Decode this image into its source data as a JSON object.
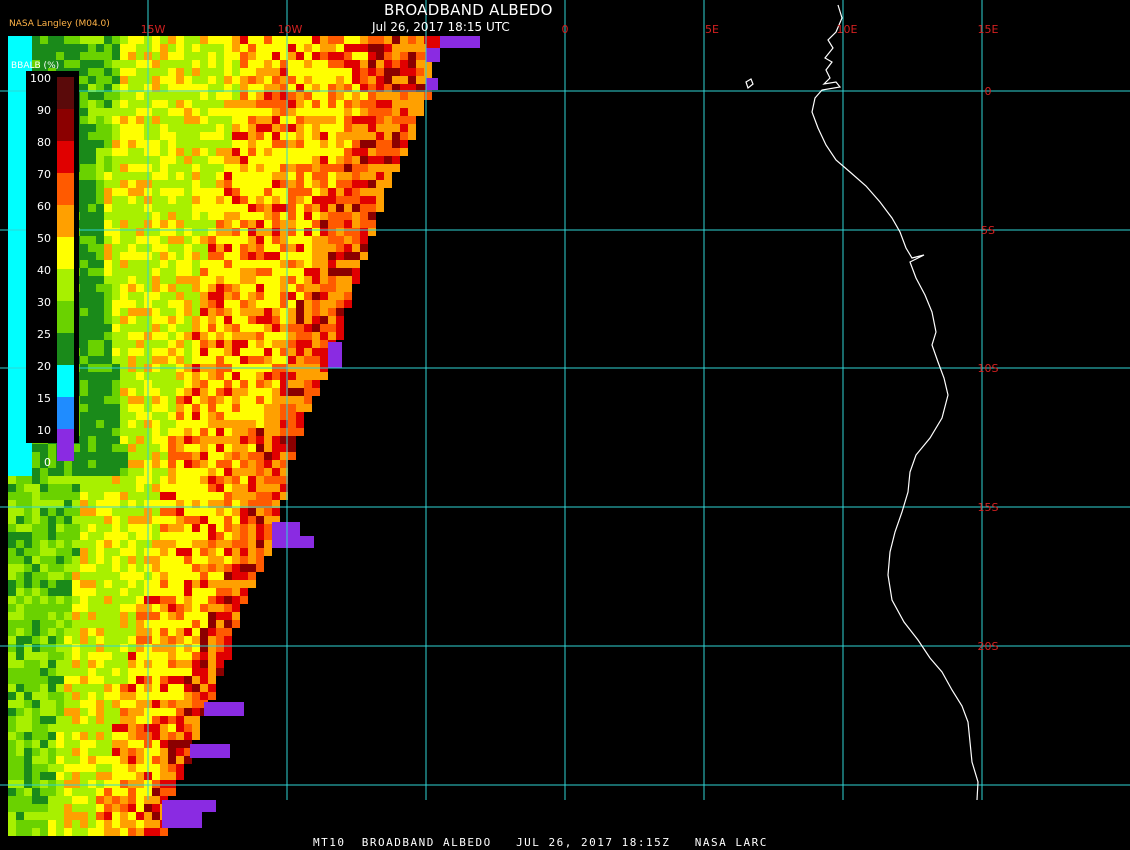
{
  "header": {
    "title": "BROADBAND ALBEDO",
    "subtitle": "Jul 26, 2017 18:15 UTC",
    "producer": "NASA Langley (M04.0)"
  },
  "footer": {
    "text": "MT10  BROADBAND ALBEDO   JUL 26, 2017 18:15Z   NASA LARC"
  },
  "map": {
    "lon_labels": [
      "15W",
      "10W",
      "0",
      "5E",
      "10E",
      "15E"
    ],
    "lat_labels": [
      "0",
      "5S",
      "10S",
      "15S",
      "20S"
    ],
    "grid_color": "#2fd4d4",
    "label_color": "#d42020",
    "coast_color": "#ffffff",
    "background": "#000000"
  },
  "legend": {
    "title": "BBALB (%)",
    "labels": [
      "100",
      "90",
      "80",
      "70",
      "60",
      "50",
      "40",
      "30",
      "25",
      "20",
      "15",
      "10",
      "0"
    ],
    "colors": [
      "#5a0a0a",
      "#8b0000",
      "#e00000",
      "#ff5a00",
      "#ffa000",
      "#ffff00",
      "#a8f000",
      "#6ad200",
      "#1a8a1a",
      "#00ffff",
      "#1f8cff",
      "#0000e0",
      "#8a2be2"
    ]
  }
}
